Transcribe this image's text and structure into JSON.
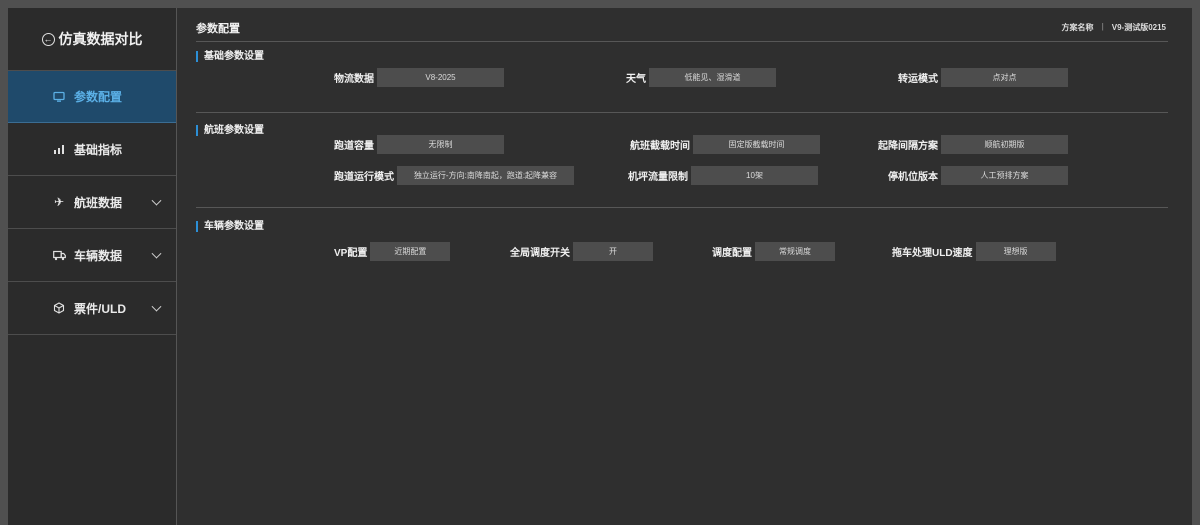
{
  "app": {
    "back_label": "仿真数据对比"
  },
  "sidebar": {
    "items": [
      {
        "label": "参数配置",
        "icon": "monitor-icon"
      },
      {
        "label": "基础指标",
        "icon": "chart-icon"
      },
      {
        "label": "航班数据",
        "icon": "plane-icon"
      },
      {
        "label": "车辆数据",
        "icon": "truck-icon"
      },
      {
        "label": "票件/ULD",
        "icon": "cube-icon"
      }
    ],
    "active_color": "#1f4a6b"
  },
  "header": {
    "title": "参数配置",
    "scheme_label": "方案名称",
    "scheme_value": "V9-测试版0215"
  },
  "sections": {
    "basic": {
      "title": "基础参数设置",
      "logistics": {
        "label": "物流数据",
        "value": "V8-2025"
      },
      "weather": {
        "label": "天气",
        "value": "低能见、湿滑道"
      },
      "transfer": {
        "label": "转运模式",
        "value": "点对点"
      }
    },
    "flight": {
      "title": "航班参数设置",
      "runway_capacity": {
        "label": "跑道容量",
        "value": "无限制"
      },
      "cutoff_time": {
        "label": "航班截载时间",
        "value": "固定版截载时间"
      },
      "interval_plan": {
        "label": "起降间隔方案",
        "value": "顺航初期版"
      },
      "runway_mode": {
        "label": "跑道运行模式",
        "value": "独立运行-方向:南降南起，跑道:起降兼容"
      },
      "apron_limit": {
        "label": "机坪流量限制",
        "value": "10架"
      },
      "stand_version": {
        "label": "停机位版本",
        "value": "人工预排方案"
      }
    },
    "vehicle": {
      "title": "车辆参数设置",
      "vp_config": {
        "label": "VP配置",
        "value": "近期配置"
      },
      "global_switch": {
        "label": "全局调度开关",
        "value": "开"
      },
      "dispatch_config": {
        "label": "调度配置",
        "value": "常规调度"
      },
      "tractor_speed": {
        "label": "拖车处理ULD速度",
        "value": "理想版"
      }
    }
  },
  "colors": {
    "accent": "#2c8fd6",
    "background": "#2f2f2f",
    "field_bg": "#4d4d4d"
  }
}
